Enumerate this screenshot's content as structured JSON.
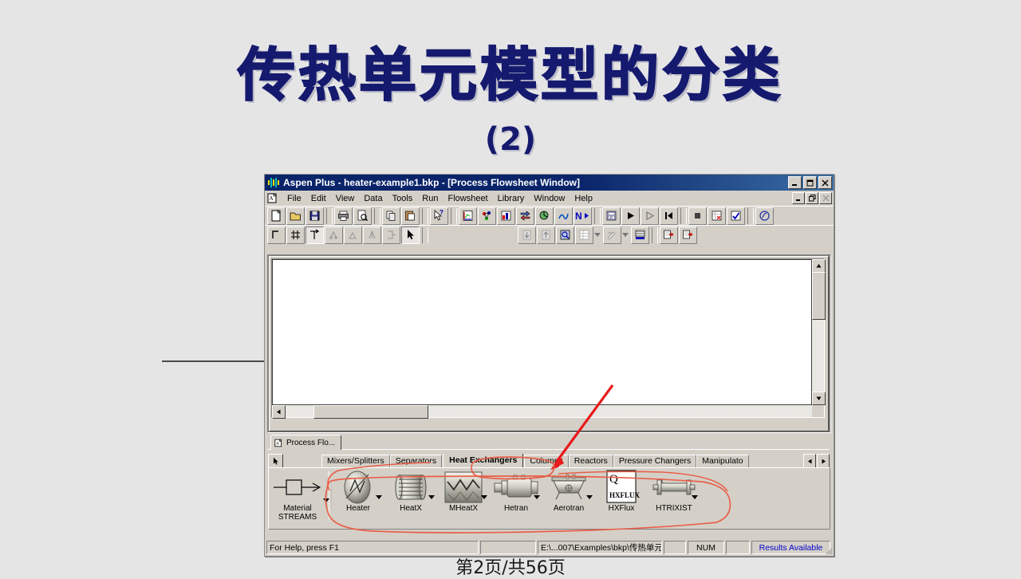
{
  "slide": {
    "title": "传热单元模型的分类",
    "subtitle": "(2)",
    "footer": "第2页/共56页",
    "background_color": "#e5e5e6",
    "title_color": "#151a6e"
  },
  "app": {
    "titlebar": {
      "text": "Aspen Plus - heater-example1.bkp - [Process Flowsheet Window]",
      "icon": "aspen-bars-icon",
      "color": "#0a246a",
      "buttons": [
        {
          "name": "minimize",
          "glyph": "_"
        },
        {
          "name": "maximize",
          "glyph": "❐"
        },
        {
          "name": "close",
          "glyph": "✕"
        }
      ]
    },
    "menubar": {
      "doc_icon": "document-icon",
      "items": [
        {
          "label": "File",
          "accel": "F"
        },
        {
          "label": "Edit",
          "accel": "E"
        },
        {
          "label": "View",
          "accel": "V"
        },
        {
          "label": "Data",
          "accel": "D"
        },
        {
          "label": "Tools",
          "accel": "T"
        },
        {
          "label": "Run",
          "accel": "R"
        },
        {
          "label": "Flowsheet",
          "accel": "F"
        },
        {
          "label": "Library",
          "accel": "b"
        },
        {
          "label": "Window",
          "accel": "W"
        },
        {
          "label": "Help",
          "accel": "H"
        }
      ],
      "child_buttons": [
        {
          "name": "child-minimize",
          "glyph": "_"
        },
        {
          "name": "child-restore",
          "glyph": "❐"
        },
        {
          "name": "child-close",
          "glyph": "✕"
        }
      ]
    },
    "toolbar_row1": [
      "new-icon",
      "open-icon",
      "save-icon",
      "print-icon",
      "print-preview-icon",
      "copy-icon",
      "paste-icon",
      "help-pointer-icon",
      "setup-icon",
      "components-icon",
      "properties-icon",
      "streams-icon",
      "blocks-icon",
      "results-icon",
      "next-icon",
      "control-panel-icon",
      "run-icon",
      "step-icon",
      "reinitialize-icon",
      "stop-icon",
      "reconcile-icon",
      "check-icon",
      "about-icon"
    ],
    "toolbar_row2": [
      "draw-region-icon",
      "grid-icon",
      "connect-icon",
      "align-left-icon",
      "align-center-icon",
      "align-top-icon",
      "flip-icon",
      "select-arrow-icon",
      "zoom-in-icon",
      "zoom-out-icon",
      "zoom-full-icon",
      "table-icon",
      "annotate-icon",
      "global-data-icon",
      "stream-results-icon",
      "block-results-icon"
    ],
    "flowsheet": {
      "canvas_color": "#ffffff",
      "vscroll": {
        "up": "▲",
        "down": "▼"
      },
      "hscroll": {
        "left": "◀",
        "right": "▶"
      }
    },
    "window_tab": {
      "label": "Process Flo...",
      "icon": "document-icon"
    },
    "palette": {
      "cursor_button": "select-arrow-icon",
      "tabs": [
        {
          "label": "Mixers/Splitters",
          "active": false
        },
        {
          "label": "Separators",
          "active": false
        },
        {
          "label": "Heat Exchangers",
          "active": true
        },
        {
          "label": "Columns",
          "active": false
        },
        {
          "label": "Reactors",
          "active": false
        },
        {
          "label": "Pressure Changers",
          "active": false
        },
        {
          "label": "Manipulato",
          "active": false
        }
      ],
      "tab_scroll": {
        "left": "◀",
        "right": "▶"
      },
      "items": [
        {
          "label_top": "Material",
          "label_bottom": "STREAMS",
          "icon": "material-stream-icon",
          "caret": true
        },
        {
          "label_top": "",
          "label_bottom": "Heater",
          "icon": "heater-icon",
          "caret": true
        },
        {
          "label_top": "",
          "label_bottom": "HeatX",
          "icon": "heatx-icon",
          "caret": true
        },
        {
          "label_top": "",
          "label_bottom": "MHeatX",
          "icon": "mheatx-icon",
          "caret": true
        },
        {
          "label_top": "",
          "label_bottom": "Hetran",
          "icon": "hetran-icon",
          "caret": true
        },
        {
          "label_top": "",
          "label_bottom": "Aerotran",
          "icon": "aerotran-icon",
          "caret": true
        },
        {
          "label_top": "",
          "label_bottom": "HXFlux",
          "icon": "hxflux-icon",
          "caret": false
        },
        {
          "label_top": "",
          "label_bottom": "HTRIXIST",
          "icon": "htrixist-icon",
          "caret": true
        }
      ],
      "hxflux_box_label": "HXFLUX",
      "hxflux_box_q": "Q"
    },
    "statusbar": {
      "help_text": "For Help, press F1",
      "path": "E:\\...007\\Examples\\bkp\\传热单元",
      "num": "NUM",
      "results": "Results Available",
      "results_color": "#0000cd"
    }
  },
  "annotations": {
    "arrow_color": "#e8191c",
    "circle_color": "#e8604a",
    "arrow_target": "Heat Exchangers tab",
    "circle_target": "Heat exchanger model palette"
  }
}
